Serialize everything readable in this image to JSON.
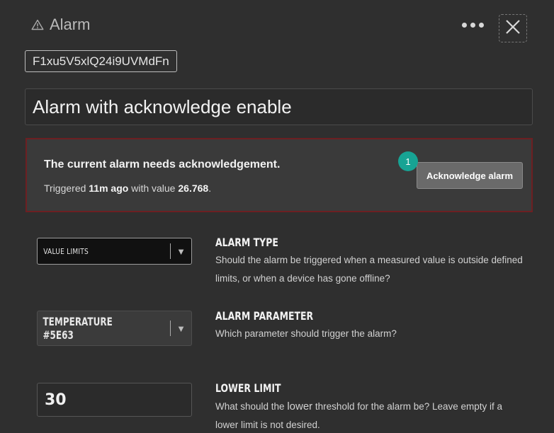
{
  "header": {
    "title": "Alarm",
    "icon": "warning-triangle-icon"
  },
  "alarm_id": "F1xu5V5xlQ24i9UVMdFn",
  "title_input": {
    "value": "Alarm with acknowledge enable"
  },
  "alert": {
    "heading": "The current alarm needs acknowledgement.",
    "triggered_prefix": "Triggered ",
    "triggered_time": "11m ago",
    "triggered_mid": " with value ",
    "triggered_value": "26.768",
    "triggered_suffix": ".",
    "button_label": "Acknowledge alarm",
    "step_badge": "1",
    "border_color": "#6d1f22",
    "badge_color": "#17a394"
  },
  "settings": {
    "alarm_type": {
      "value": "VALUE LIMITS",
      "label": "ALARM TYPE",
      "description": "Should the alarm be triggered when a measured value is outside defined limits, or when a device has gone offline?"
    },
    "alarm_parameter": {
      "value": "TEMPERATURE #5E63",
      "label": "ALARM PARAMETER",
      "description": "Which parameter should trigger the alarm?"
    },
    "lower_limit": {
      "value": "30",
      "label": "LOWER LIMIT",
      "description_prefix": "What should the ",
      "description_emph": "lower",
      "description_suffix": " threshold for the alarm be? Leave empty if a lower limit is not desired."
    }
  }
}
